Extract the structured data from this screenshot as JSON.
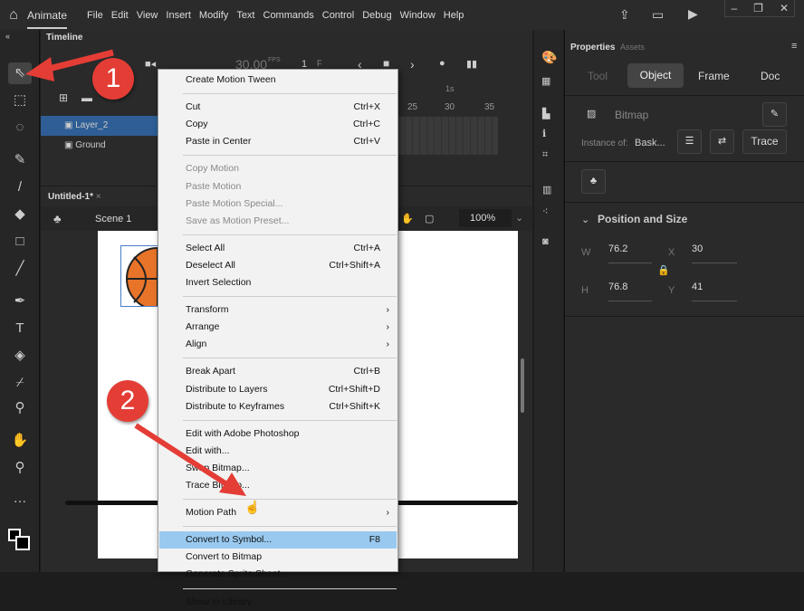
{
  "menubar": {
    "app": "Animate",
    "items": [
      "File",
      "Edit",
      "View",
      "Insert",
      "Modify",
      "Text",
      "Commands",
      "Control",
      "Debug",
      "Window",
      "Help"
    ]
  },
  "timeline": {
    "tab": "Timeline",
    "fps": "30.00",
    "fps_unit": "FPS",
    "frame": "1",
    "frame_label": "F",
    "ruler_second": "1s",
    "ruler": [
      "25",
      "30",
      "35"
    ],
    "layers": [
      "Layer_2",
      "Ground"
    ]
  },
  "document": {
    "tab": "Untitled-1*",
    "close": "×",
    "scene": "Scene 1",
    "zoom": "100%"
  },
  "properties": {
    "tabs": [
      "Properties",
      "Assets"
    ],
    "subtabs": [
      "Tool",
      "Object",
      "Frame",
      "Doc"
    ],
    "active_subtab": "Object",
    "type": "Bitmap",
    "instance_label": "Instance of:",
    "instance_value": "Bask...",
    "trace": "Trace",
    "section": "Position and Size",
    "w_label": "W",
    "w": "76.2",
    "h_label": "H",
    "h": "76.8",
    "x_label": "X",
    "x": "30",
    "y_label": "Y",
    "y": "41"
  },
  "context_menu": [
    {
      "label": "Create Motion Tween"
    },
    {
      "sep": true
    },
    {
      "label": "Cut",
      "shortcut": "Ctrl+X"
    },
    {
      "label": "Copy",
      "shortcut": "Ctrl+C"
    },
    {
      "label": "Paste in Center",
      "shortcut": "Ctrl+V"
    },
    {
      "sep": true
    },
    {
      "label": "Copy Motion",
      "disabled": true
    },
    {
      "label": "Paste Motion",
      "disabled": true
    },
    {
      "label": "Paste Motion Special...",
      "disabled": true
    },
    {
      "label": "Save as Motion Preset...",
      "disabled": true
    },
    {
      "sep": true
    },
    {
      "label": "Select All",
      "shortcut": "Ctrl+A"
    },
    {
      "label": "Deselect All",
      "shortcut": "Ctrl+Shift+A"
    },
    {
      "label": "Invert Selection"
    },
    {
      "sep": true
    },
    {
      "label": "Transform",
      "submenu": true
    },
    {
      "label": "Arrange",
      "submenu": true
    },
    {
      "label": "Align",
      "submenu": true
    },
    {
      "sep": true
    },
    {
      "label": "Break Apart",
      "shortcut": "Ctrl+B"
    },
    {
      "label": "Distribute to Layers",
      "shortcut": "Ctrl+Shift+D"
    },
    {
      "label": "Distribute to Keyframes",
      "shortcut": "Ctrl+Shift+K"
    },
    {
      "sep": true
    },
    {
      "label": "Edit with Adobe Photoshop"
    },
    {
      "label": "Edit with..."
    },
    {
      "label": "Swap Bitmap..."
    },
    {
      "label": "Trace Bitmap..."
    },
    {
      "sep": true
    },
    {
      "label": "Motion Path",
      "submenu": true
    },
    {
      "sep": true
    },
    {
      "label": "Convert to Symbol...",
      "shortcut": "F8",
      "highlighted": true
    },
    {
      "label": "Convert to Bitmap"
    },
    {
      "label": "Generate Sprite Sheet..."
    },
    {
      "sep": true
    },
    {
      "label": "Show In Library"
    }
  ],
  "annotations": [
    "1",
    "2"
  ],
  "colors": {
    "accent": "#e43d36",
    "highlight": "#99c9ef",
    "layer_selected": "#2e5e95"
  }
}
